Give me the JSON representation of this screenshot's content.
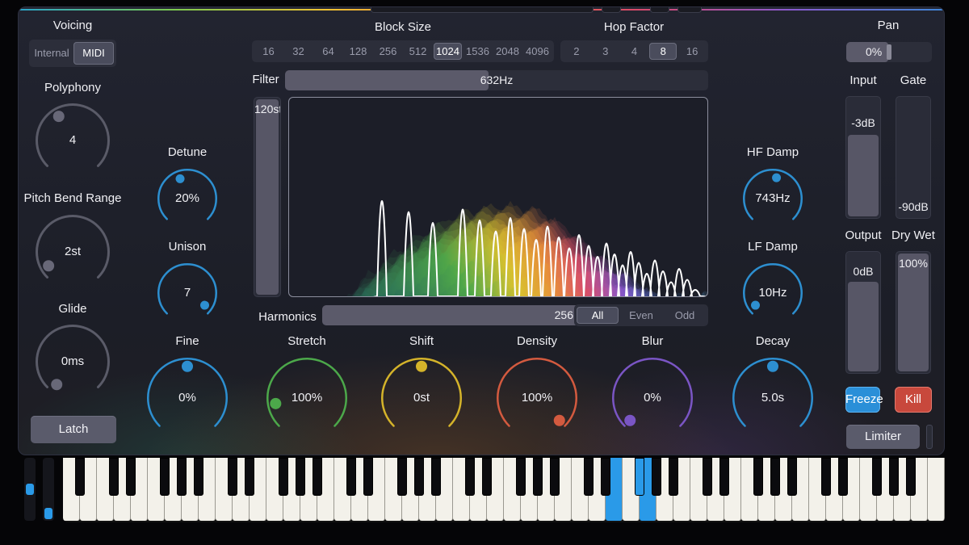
{
  "voicing": {
    "label": "Voicing",
    "options": [
      "Internal",
      "MIDI"
    ],
    "selected": "MIDI"
  },
  "polyphony": {
    "label": "Polyphony",
    "value": "4"
  },
  "pitch_bend": {
    "label": "Pitch Bend Range",
    "value": "2st"
  },
  "glide": {
    "label": "Glide",
    "value": "0ms"
  },
  "latch": {
    "label": "Latch"
  },
  "detune": {
    "label": "Detune",
    "value": "20%"
  },
  "unison": {
    "label": "Unison",
    "value": "7"
  },
  "block_size": {
    "label": "Block Size",
    "options": [
      "16",
      "32",
      "64",
      "128",
      "256",
      "512",
      "1024",
      "1536",
      "2048",
      "4096"
    ],
    "selected": "1024"
  },
  "hop_factor": {
    "label": "Hop Factor",
    "options": [
      "2",
      "3",
      "4",
      "8",
      "16"
    ],
    "selected": "8"
  },
  "filter": {
    "label": "Filter",
    "value": "632Hz",
    "level": 0.48
  },
  "pitch_range": {
    "value": "120st"
  },
  "harmonics": {
    "label": "Harmonics",
    "value": "256",
    "level": 1.0,
    "modes": [
      "All",
      "Even",
      "Odd"
    ],
    "selected": "All"
  },
  "pan": {
    "label": "Pan",
    "value": "0%"
  },
  "input": {
    "label": "Input",
    "value": "-3dB",
    "level": 0.7
  },
  "gate": {
    "label": "Gate",
    "value": "-90dB",
    "level": 0.0
  },
  "output": {
    "label": "Output",
    "value": "0dB",
    "level": 0.77
  },
  "dry_wet": {
    "label": "Dry Wet",
    "value": "100%",
    "level": 1.0
  },
  "hf_damp": {
    "label": "HF Damp",
    "value": "743Hz"
  },
  "lf_damp": {
    "label": "LF Damp",
    "value": "10Hz"
  },
  "freeze": {
    "label": "Freeze"
  },
  "kill": {
    "label": "Kill"
  },
  "limiter": {
    "label": "Limiter"
  },
  "bottom_knobs": [
    {
      "name": "fine",
      "label": "Fine",
      "value": "0%",
      "color": "#2d8fd0"
    },
    {
      "name": "stretch",
      "label": "Stretch",
      "value": "100%",
      "color": "#4ca84a"
    },
    {
      "name": "shift",
      "label": "Shift",
      "value": "0st",
      "color": "#d4b32a"
    },
    {
      "name": "density",
      "label": "Density",
      "value": "100%",
      "color": "#d35a3f"
    },
    {
      "name": "blur",
      "label": "Blur",
      "value": "0%",
      "color": "#7a55c4"
    },
    {
      "name": "decay",
      "label": "Decay",
      "value": "5.0s",
      "color": "#2d8fd0"
    }
  ],
  "colors": {
    "accent": "#2a9ae8",
    "freeze": "#2a8fd8",
    "kill": "#c8483c"
  }
}
